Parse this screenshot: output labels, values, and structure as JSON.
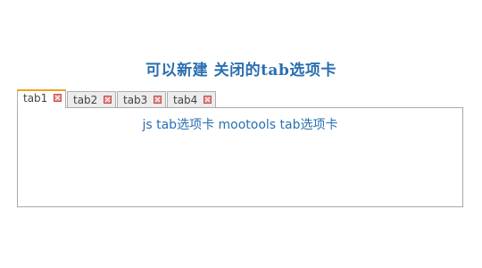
{
  "heading": "可以新建 关闭的tab选项卡",
  "tabs": [
    {
      "label": "tab1",
      "active": true
    },
    {
      "label": "tab2",
      "active": false
    },
    {
      "label": "tab3",
      "active": false
    },
    {
      "label": "tab4",
      "active": false
    }
  ],
  "panel": {
    "content": "js tab选项卡 mootools tab选项卡"
  },
  "colors": {
    "accent_text": "#2a6fb0",
    "active_tab_border": "#f0a020",
    "close_icon": "#e48b8b"
  },
  "icons": {
    "tab_close": "close-icon"
  }
}
